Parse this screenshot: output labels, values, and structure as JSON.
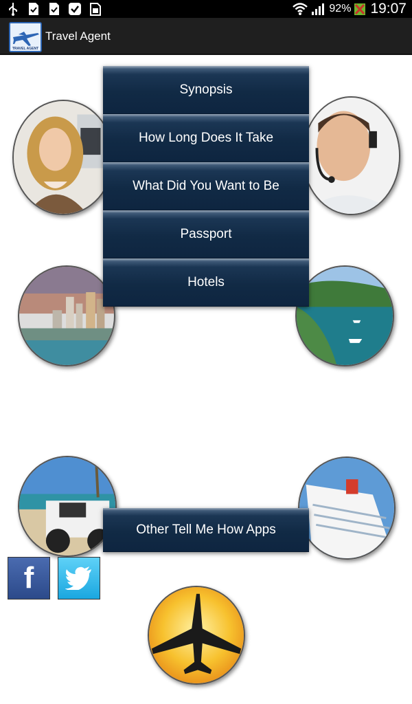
{
  "status_bar": {
    "battery_percent": "92%",
    "time": "19:07",
    "icons": [
      "usb-icon",
      "download-done-icon",
      "download-done-icon",
      "check-box-icon",
      "sim-card-icon",
      "wifi-icon",
      "signal-icon",
      "battery-icon"
    ]
  },
  "action_bar": {
    "logo_text": "TRAVEL AGENT",
    "title": "Travel Agent"
  },
  "menu": {
    "items": [
      {
        "label": "Synopsis"
      },
      {
        "label": "How Long Does It Take"
      },
      {
        "label": "What Did You Want to Be"
      },
      {
        "label": "Passport"
      },
      {
        "label": "Hotels"
      }
    ]
  },
  "other_apps": {
    "label": "Other Tell Me How Apps"
  },
  "social": {
    "facebook_glyph": "f",
    "twitter": "twitter-bird-icon"
  },
  "colors": {
    "menu_dark": "#112a45",
    "action_bar": "#1f1f1f",
    "facebook": "#3b5998",
    "twitter": "#1da1f2"
  }
}
